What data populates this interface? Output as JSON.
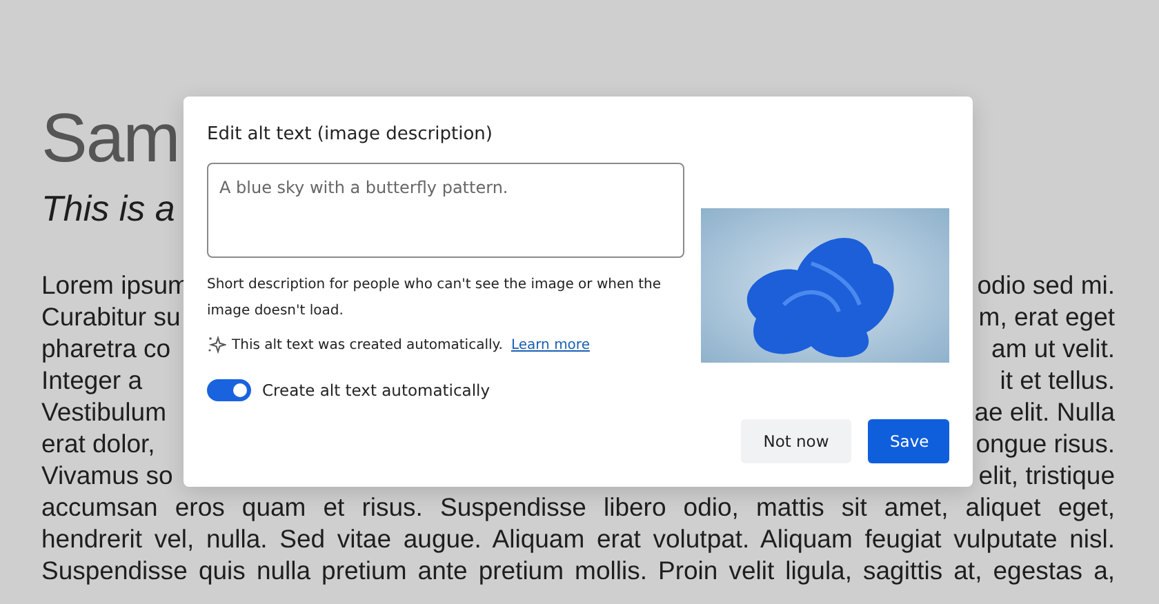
{
  "document": {
    "title": "Sam",
    "subtitle": "This is a",
    "lines": [
      {
        "left": "Lorem ipsum",
        "right": "odio sed mi."
      },
      {
        "left": "Curabitur su",
        "right": "m, erat eget"
      },
      {
        "left": "pharetra co",
        "right": "am ut velit."
      },
      {
        "left": "Integer a",
        "right": "it et tellus."
      },
      {
        "left": "Vestibulum",
        "right": "ae elit. Nulla"
      },
      {
        "left": "erat dolor,",
        "right": "ongue risus."
      },
      {
        "left": "Vivamus so",
        "right": "elit, tristique"
      },
      {
        "text": "accumsan eros quam et risus. Suspendisse libero odio, mattis sit amet, aliquet eget,"
      },
      {
        "text": "hendrerit vel, nulla. Sed vitae augue. Aliquam erat volutpat. Aliquam feugiat vulputate nisl."
      },
      {
        "text": "Suspendisse quis nulla pretium ante pretium mollis. Proin velit ligula, sagittis at, egestas a,"
      }
    ]
  },
  "dialog": {
    "title": "Edit alt text (image description)",
    "alt_text_field": {
      "value": "A blue sky with a butterfly pattern."
    },
    "help_text": "Short description for people who can't see the image or when the image doesn't load.",
    "auto_notice": "This alt text was created automatically.",
    "learn_more_link": "Learn more",
    "auto_toggle": {
      "label": "Create alt text automatically",
      "on": true
    },
    "buttons": [
      {
        "label": "Not now",
        "kind": "secondary"
      },
      {
        "label": "Save",
        "kind": "primary"
      }
    ]
  }
}
